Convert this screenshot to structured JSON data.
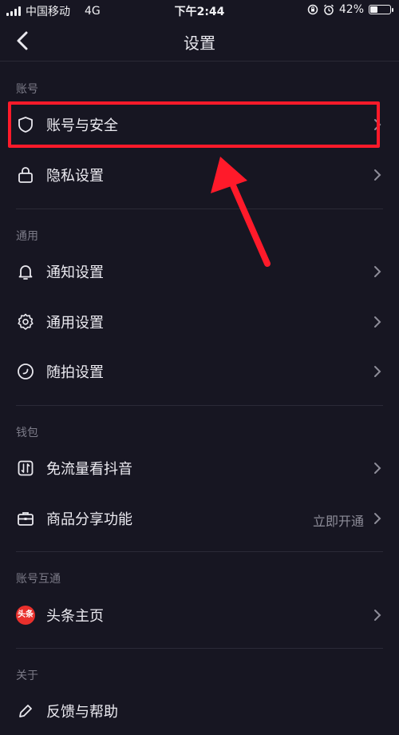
{
  "status_bar": {
    "carrier": "中国移动",
    "network": "4G",
    "time": "下午2:44",
    "battery_percent": "42%",
    "battery_level": 0.42
  },
  "navbar": {
    "title": "设置",
    "back_icon": "chevron-left-icon"
  },
  "sections": [
    {
      "label": "账号",
      "items": [
        {
          "label": "账号与安全",
          "icon": "shield-icon"
        },
        {
          "label": "隐私设置",
          "icon": "lock-icon"
        }
      ]
    },
    {
      "label": "通用",
      "items": [
        {
          "label": "通知设置",
          "icon": "bell-icon"
        },
        {
          "label": "通用设置",
          "icon": "gear-icon"
        },
        {
          "label": "随拍设置",
          "icon": "clock-icon"
        }
      ]
    },
    {
      "label": "钱包",
      "items": [
        {
          "label": "免流量看抖音",
          "icon": "data-icon"
        },
        {
          "label": "商品分享功能",
          "icon": "briefcase-icon",
          "extra": "立即开通"
        }
      ]
    },
    {
      "label": "账号互通",
      "items": [
        {
          "label": "头条主页",
          "icon": "toutiao-logo",
          "badge": "头条"
        }
      ]
    },
    {
      "label": "关于",
      "items": [
        {
          "label": "反馈与帮助",
          "icon": "pencil-icon"
        }
      ]
    }
  ],
  "annotation": {
    "highlight_color": "#ff1a2a",
    "arrow_color": "#ff1a2a"
  }
}
